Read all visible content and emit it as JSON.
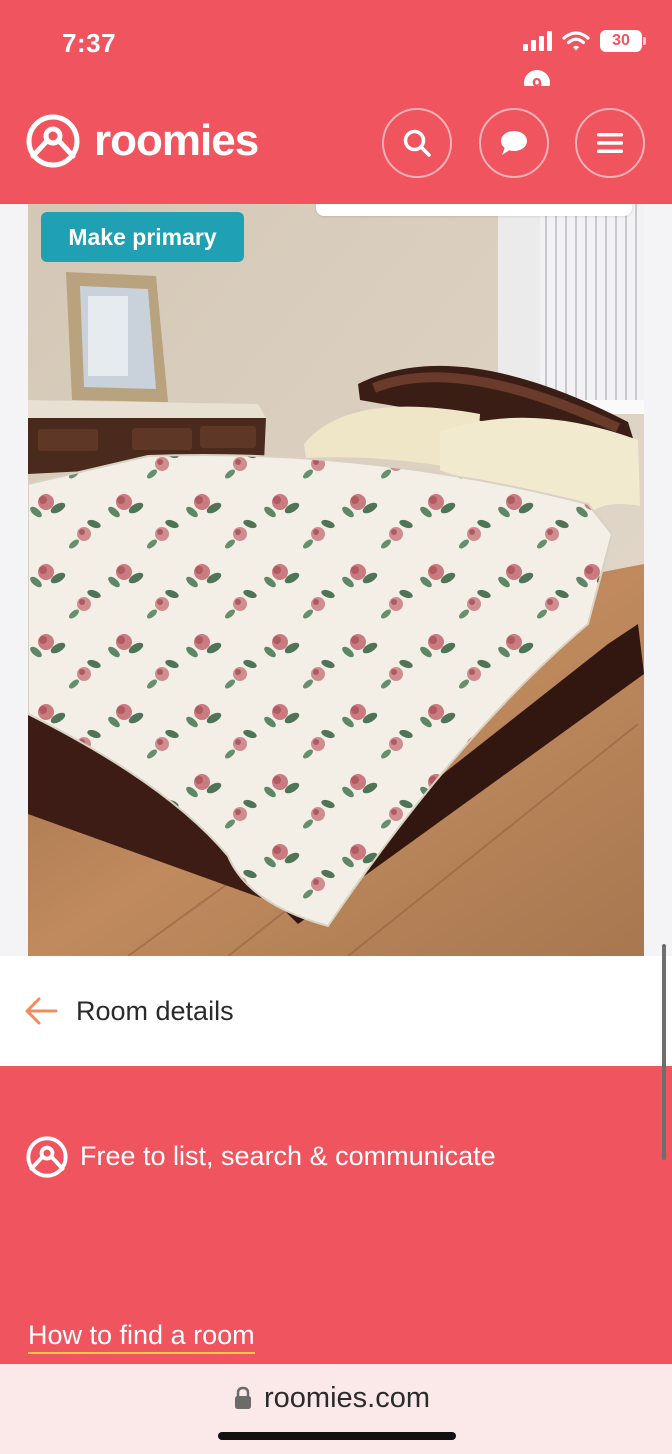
{
  "status": {
    "time": "7:37",
    "battery": "30"
  },
  "brand": {
    "name": "roomies",
    "color": "#f0545e"
  },
  "nav": {
    "chat_badge": "9"
  },
  "photo": {
    "primary_button": "Make primary"
  },
  "details": {
    "title": "Room details"
  },
  "footer": {
    "tagline": "Free to list, search & communicate",
    "link": "How to find a room"
  },
  "browser": {
    "url": "roomies.com"
  }
}
